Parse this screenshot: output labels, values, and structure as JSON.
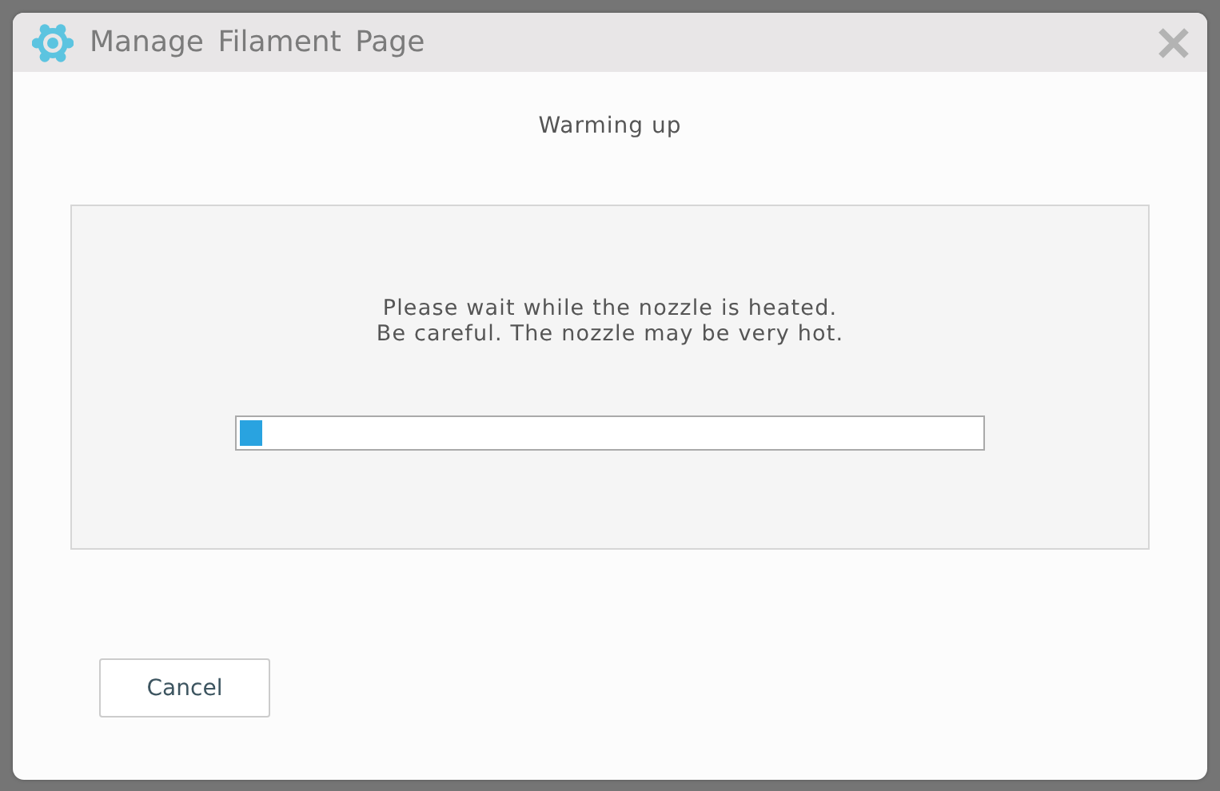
{
  "window": {
    "title": "Manage Filament Page"
  },
  "heading": "Warming up",
  "message": [
    "Please wait while the nozzle is heated.",
    "Be careful. The nozzle may be very hot."
  ],
  "progress": {
    "level": 0.03
  },
  "buttons": [
    "Cancel"
  ]
}
